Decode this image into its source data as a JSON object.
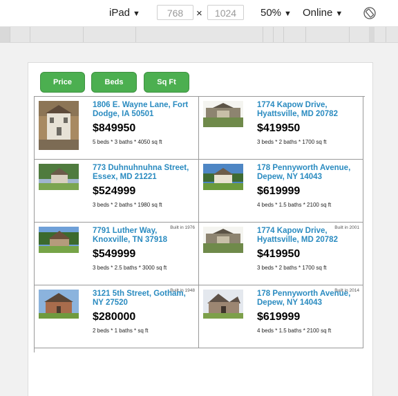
{
  "toolbar": {
    "device": "iPad",
    "width": "768",
    "times": "×",
    "height": "1024",
    "zoom": "50%",
    "network": "Online",
    "caret": "▼",
    "rotate_icon": "rotate-icon"
  },
  "sort_buttons": [
    "Price",
    "Beds",
    "Sq Ft"
  ],
  "listings": [
    {
      "address": "1806 E. Wayne Lane, Fort Dodge, IA 50501",
      "price": "$849950",
      "details": "5 beds * 3 baths * 4050 sq ft",
      "built": ""
    },
    {
      "address": "1774 Kapow Drive, Hyattsville, MD 20782",
      "price": "$419950",
      "details": "3 beds * 2 baths * 1700 sq ft",
      "built": ""
    },
    {
      "address": "773 Duhnuhnuhna Street, Essex, MD 21221",
      "price": "$524999",
      "details": "3 beds * 2 baths * 1980 sq ft",
      "built": ""
    },
    {
      "address": "178 Pennyworth Avenue, Depew, NY 14043",
      "price": "$619999",
      "details": "4 beds * 1.5 baths * 2100 sq ft",
      "built": ""
    },
    {
      "address": "7791 Luther Way, Knoxville, TN 37918",
      "price": "$549999",
      "details": "3 beds * 2.5 baths * 3000 sq ft",
      "built": "Built in 1976"
    },
    {
      "address": "1774 Kapow Drive, Hyattsville, MD 20782",
      "price": "$419950",
      "details": "3 beds * 2 baths * 1700 sq ft",
      "built": "Built in 2001"
    },
    {
      "address": "3121 5th Street, Gotham, NY 27520",
      "price": "$280000",
      "details": "2 beds * 1 baths * sq ft",
      "built": "Built in 1948"
    },
    {
      "address": "178 Pennyworth Avenue, Depew, NY 14043",
      "price": "$619999",
      "details": "4 beds * 1.5 baths * 2100 sq ft",
      "built": "Built in 2014"
    }
  ],
  "colors": {
    "button_green": "#4caf50",
    "address_blue": "#2a8bc0"
  }
}
